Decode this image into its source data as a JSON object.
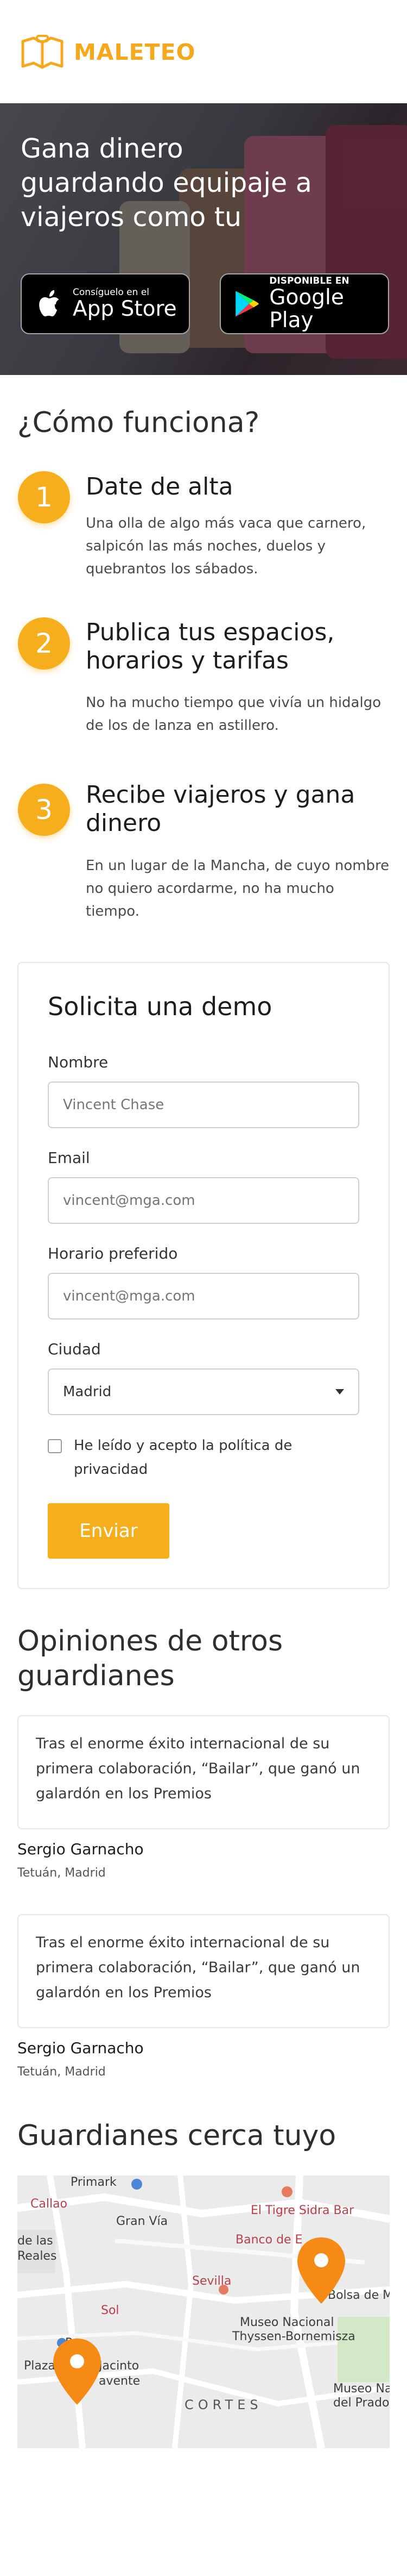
{
  "header": {
    "brand": "MALETEO",
    "logo_icon": "map-book-icon",
    "brand_color": "#f5a81c"
  },
  "hero": {
    "title": "Gana dinero guardando equipaje a viajeros como tu",
    "appstore": {
      "small": "Consíguelo en el",
      "big": "App Store",
      "icon": "apple-icon"
    },
    "googleplay": {
      "small": "DISPONIBLE EN",
      "big": "Google Play",
      "icon": "google-play-icon"
    }
  },
  "how": {
    "title": "¿Cómo funciona?",
    "accent": "#f7ae1d",
    "steps": [
      {
        "num": "1",
        "title": "Date de alta",
        "desc": "Una olla de algo más vaca que carnero, salpicón las más noches, duelos y quebrantos los sábados."
      },
      {
        "num": "2",
        "title": "Publica tus espacios, horarios y tarifas",
        "desc": "No ha mucho tiempo que vivía un hidalgo de los de lanza en astillero."
      },
      {
        "num": "3",
        "title": "Recibe viajeros y gana dinero",
        "desc": "En un lugar de la Mancha, de cuyo nombre no quiero acordarme, no ha mucho tiempo."
      }
    ]
  },
  "form": {
    "title": "Solicita una demo",
    "name_label": "Nombre",
    "name_placeholder": "Vincent Chase",
    "email_label": "Email",
    "email_placeholder": "vincent@mga.com",
    "schedule_label": "Horario preferido",
    "schedule_placeholder": "vincent@mga.com",
    "city_label": "Ciudad",
    "city_value": "Madrid",
    "privacy_label": "He leído y acepto la política de privacidad",
    "submit_label": "Enviar"
  },
  "reviews": {
    "title": "Opiniones de otros guardianes",
    "items": [
      {
        "text": "Tras el enorme éxito internacional de su primera colaboración, “Bailar”, que ganó un galardón en los Premios",
        "name": "Sergio Garnacho",
        "place": "Tetuán, Madrid"
      },
      {
        "text": "Tras el enorme éxito internacional de su primera colaboración, “Bailar”, que ganó un galardón en los Premios",
        "name": "Sergio Garnacho",
        "place": "Tetuán, Madrid"
      }
    ]
  },
  "map": {
    "title": "Guardianes cerca tuyo",
    "labels": {
      "primark": "Primark",
      "callao": "Callao",
      "gran_via": "Gran Vía",
      "el_tigre": "El Tigre Sidra Bar",
      "banco": "Banco de E",
      "de_las": "de las",
      "reales": "Reales",
      "sevilla": "Sevilla",
      "bolsa": "Bolsa de Ma",
      "sol": "Sol",
      "museo": "Museo Nacional",
      "thyssen": "Thyssen-Bornemisza",
      "plaza": "Plaza",
      "jacinto": "Jacinto",
      "avente": "avente",
      "rt": "R",
      "cortes": "CORTES",
      "museo_nac2": "Museo Nac",
      "del_prado": "del Prado"
    }
  }
}
